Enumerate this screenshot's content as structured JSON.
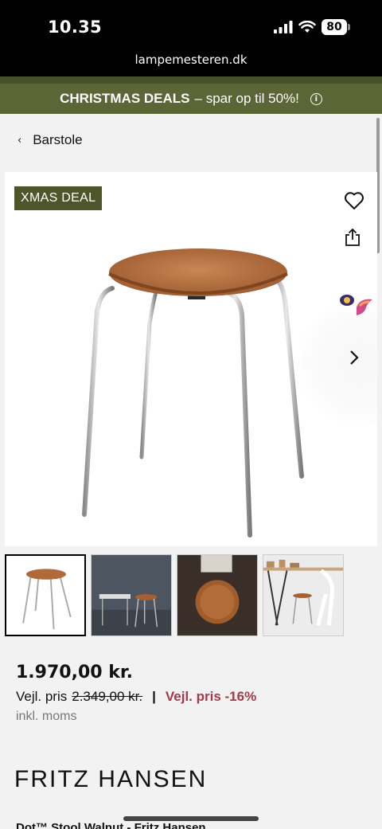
{
  "status_bar": {
    "time": "10.35",
    "battery": "80",
    "url": "lampemesteren.dk",
    "icons": [
      "signal-icon",
      "wifi-icon",
      "battery-icon"
    ]
  },
  "promo": {
    "bold": "CHRISTMAS DEALS",
    "text": "– spar op til 50%!",
    "info_glyph": "i",
    "background": "#5b6536"
  },
  "breadcrumb": {
    "label": "Barstole"
  },
  "product_image": {
    "badge": "XMAS DEAL",
    "badge_color": "#4d5529",
    "icons": [
      "heart-icon",
      "share-icon",
      "chevron-right-icon"
    ]
  },
  "thumbnails": {
    "count": 4,
    "selected_index": 0
  },
  "pricing": {
    "price": "1.970,00 kr.",
    "rrp_label": "Vejl. pris",
    "rrp_value": "2.349,00 kr.",
    "separator": "|",
    "discount": "Vejl. pris -16%",
    "discount_color": "#a23a4c",
    "vat_note": "inkl. moms"
  },
  "brand": {
    "name": "FRITZ HANSEN"
  },
  "product": {
    "title": "Dot™ Stool Walnut - Fritz Hansen"
  }
}
